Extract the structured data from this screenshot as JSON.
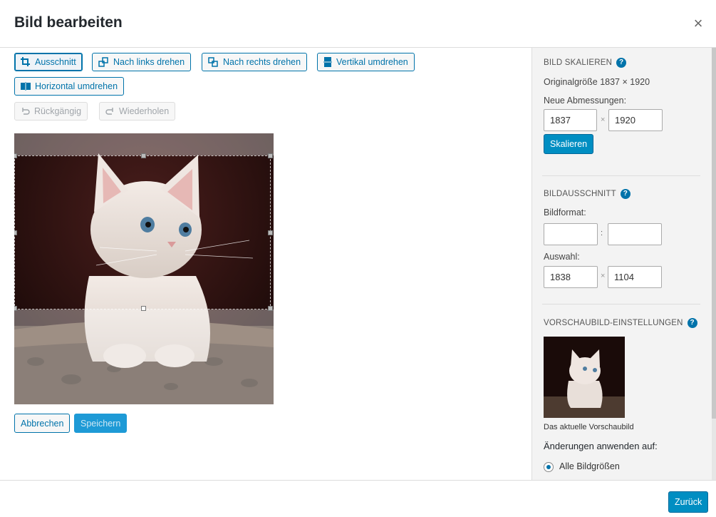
{
  "header": {
    "title": "Bild bearbeiten",
    "close_label": "×"
  },
  "toolbar": {
    "crop": "Ausschnitt",
    "rotate_left": "Nach links drehen",
    "rotate_right": "Nach rechts drehen",
    "flip_vertical": "Vertikal umdrehen",
    "flip_horizontal": "Horizontal umdrehen",
    "undo": "Rückgängig",
    "redo": "Wiederholen"
  },
  "actions": {
    "cancel": "Abbrechen",
    "save": "Speichern",
    "back": "Zurück"
  },
  "scale": {
    "title": "BILD SKALIEREN",
    "original_size": "Originalgröße 1837 × 1920",
    "new_dimensions_label": "Neue Abmessungen:",
    "width": "1837",
    "height": "1920",
    "times": "×",
    "button": "Skalieren"
  },
  "crop_section": {
    "title": "BILDAUSSCHNITT",
    "format_label": "Bildformat:",
    "ratio_sep": ":",
    "ratio_w": "",
    "ratio_h": "",
    "selection_label": "Auswahl:",
    "sel_w": "1838",
    "sel_h": "1104",
    "times": "×"
  },
  "thumbnail": {
    "title": "VORSCHAUBILD-EINSTELLUNGEN",
    "caption": "Das aktuelle Vorschaubild",
    "apply_label": "Änderungen anwenden auf:",
    "option_all": "Alle Bildgrößen"
  },
  "colors": {
    "accent": "#0073aa",
    "primary": "#008ec2"
  }
}
